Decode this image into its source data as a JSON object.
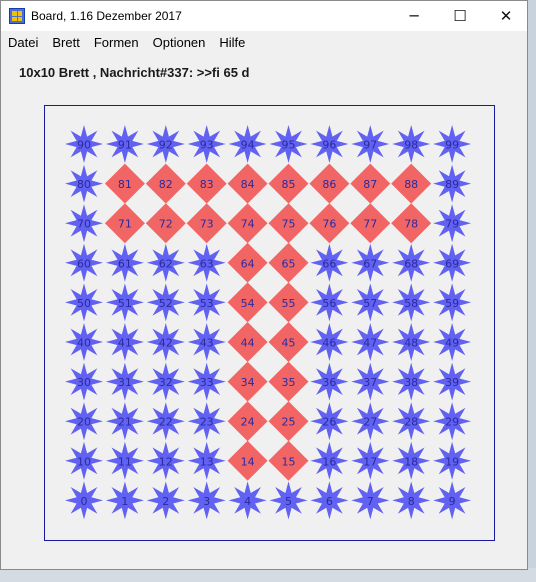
{
  "window": {
    "title": "Board, 1.16 Dezember 2017",
    "controls": {
      "minimize": "─",
      "maximize": "☐",
      "close": "✕"
    }
  },
  "menu": [
    "Datei",
    "Brett",
    "Formen",
    "Optionen",
    "Hilfe"
  ],
  "status": "10x10 Brett , Nachricht#337: >>fi 65 d",
  "board": {
    "rows": 10,
    "cols": 10,
    "star_color": "#6161f2",
    "diamond_color": "#f26565",
    "label_color": "#2a2aa0",
    "diamond_cells": [
      81,
      82,
      83,
      84,
      85,
      86,
      87,
      88,
      71,
      72,
      73,
      74,
      75,
      76,
      77,
      78,
      64,
      65,
      54,
      55,
      44,
      45,
      34,
      35,
      24,
      25,
      14,
      15
    ]
  }
}
